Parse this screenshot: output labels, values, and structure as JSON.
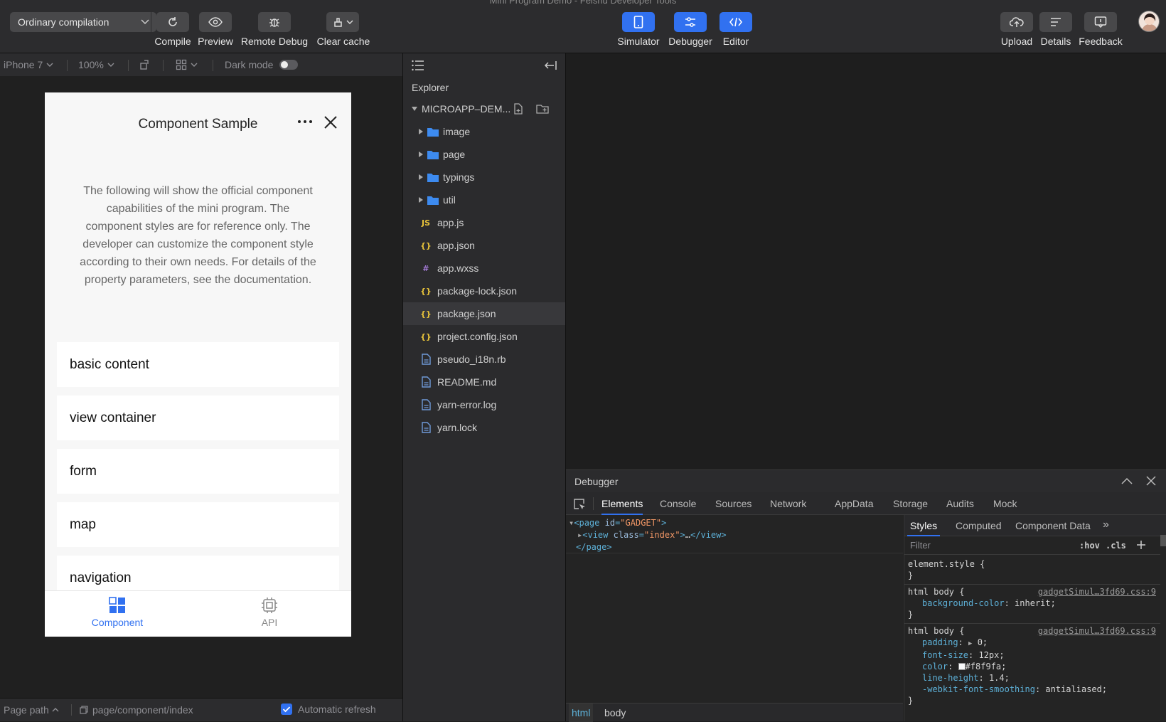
{
  "window": {
    "title": "Mini Program Demo - Feishu Developer Tools"
  },
  "toolbar": {
    "compile_mode": "Ordinary compilation",
    "compile_label": "Compile",
    "preview_label": "Preview",
    "remote_debug_label": "Remote Debug",
    "clear_cache_label": "Clear cache",
    "simulator_label": "Simulator",
    "debugger_label": "Debugger",
    "editor_label": "Editor",
    "upload_label": "Upload",
    "details_label": "Details",
    "feedback_label": "Feedback",
    "accent": "#3171f0"
  },
  "simbar": {
    "device": "iPhone 7",
    "zoom": "100%",
    "dark_mode_label": "Dark mode"
  },
  "phone": {
    "title": "Component Sample",
    "description": "The following will show the official component capabilities of the mini program. The component styles are for reference only. The developer can customize the component style according to their own needs. For details of the property parameters, see the documentation.",
    "items": [
      "basic content",
      "view container",
      "form",
      "map",
      "navigation"
    ],
    "tabs": [
      {
        "label": "Component",
        "icon": "grid-icon"
      },
      {
        "label": "API",
        "icon": "chip-icon"
      }
    ]
  },
  "pathbar": {
    "label": "Page path",
    "path": "page/component/index",
    "auto_refresh_label": "Automatic refresh"
  },
  "explorer": {
    "header": "Explorer",
    "project": "MICROAPP–DEM...",
    "folders": [
      "image",
      "page",
      "typings",
      "util"
    ],
    "files": [
      {
        "name": "app.js",
        "icon": "JS",
        "color": "#e8c33a"
      },
      {
        "name": "app.json",
        "icon": "{}",
        "color": "#e8c33a"
      },
      {
        "name": "app.wxss",
        "icon": "#",
        "color": "#a57bd8"
      },
      {
        "name": "package-lock.json",
        "icon": "{}",
        "color": "#e8c33a"
      },
      {
        "name": "package.json",
        "icon": "{}",
        "color": "#e8c33a"
      },
      {
        "name": "project.config.json",
        "icon": "{}",
        "color": "#e8c33a"
      },
      {
        "name": "pseudo_i18n.rb",
        "icon": "doc",
        "color": "#6f9ad8"
      },
      {
        "name": "README.md",
        "icon": "doc",
        "color": "#6f9ad8"
      },
      {
        "name": "yarn-error.log",
        "icon": "doc",
        "color": "#6f9ad8"
      },
      {
        "name": "yarn.lock",
        "icon": "doc",
        "color": "#6f9ad8"
      }
    ]
  },
  "debugger": {
    "title": "Debugger",
    "tabs": [
      "Elements",
      "Console",
      "Sources",
      "Network",
      "AppData",
      "Storage",
      "Audits",
      "Mock"
    ],
    "dom": {
      "line1_tag": "page",
      "line1_attr": "id",
      "line1_val": "\"GADGET\"",
      "line2_tag": "view",
      "line2_attr": "class",
      "line2_val": "\"index\"",
      "line2_ellipsis": "…",
      "line3_tag": "/page"
    },
    "breadcrumb": [
      "html",
      "body"
    ],
    "styles": {
      "tabs": [
        "Styles",
        "Computed",
        "Component Data"
      ],
      "filter_placeholder": "Filter",
      "hov": ":hov",
      "cls": ".cls",
      "element_style": "element.style {",
      "close_brace": "}",
      "rule1_selector": "html body {",
      "rule1_source": "gadgetSimul…3fd69.css:9",
      "rule1_prop": "background-color",
      "rule1_val": "inherit;",
      "rule2_selector": "html body {",
      "rule2_source": "gadgetSimul…3fd69.css:9",
      "rule2_props": [
        {
          "name": "padding",
          "val": "0;"
        },
        {
          "name": "font-size",
          "val": "12px;"
        },
        {
          "name": "color",
          "val": "#f8f9fa;"
        },
        {
          "name": "line-height",
          "val": "1.4;"
        },
        {
          "name": "-webkit-font-smoothing",
          "val": "antialiased;"
        }
      ]
    }
  }
}
